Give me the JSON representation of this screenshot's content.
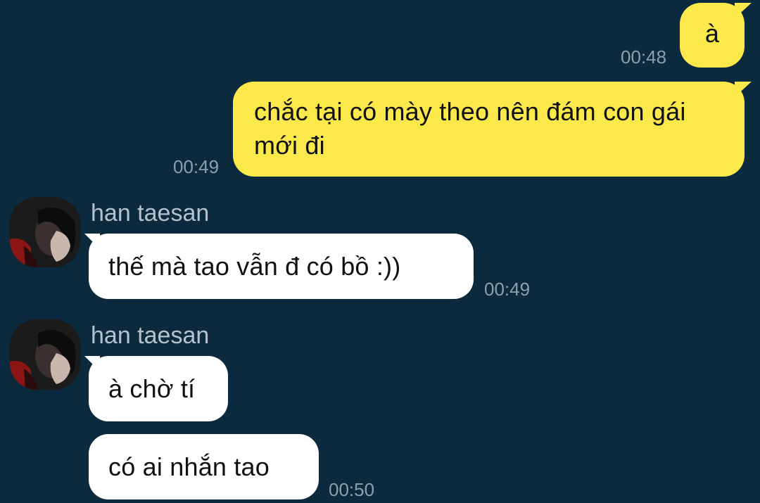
{
  "messages": [
    {
      "direction": "out",
      "text": "à",
      "time": "00:48"
    },
    {
      "direction": "out",
      "text": "chắc tại có mày theo nên đám con gái mới đi",
      "time": "00:49"
    },
    {
      "direction": "in",
      "sender": "han taesan",
      "text": "thế mà tao vẫn đ có bồ :))",
      "time": "00:49"
    },
    {
      "direction": "in",
      "sender": "han taesan",
      "text": "à chờ tí",
      "time": ""
    },
    {
      "direction": "in",
      "sender": "",
      "text": "có ai nhắn tao",
      "time": "00:50"
    }
  ],
  "colors": {
    "background": "#0b2a3d",
    "outgoing_bubble": "#fbe84a",
    "incoming_bubble": "#ffffff",
    "timestamp": "#8aa0ad",
    "sender_name": "#b3c2cb"
  },
  "icons": {
    "avatar": "profile-photo"
  }
}
